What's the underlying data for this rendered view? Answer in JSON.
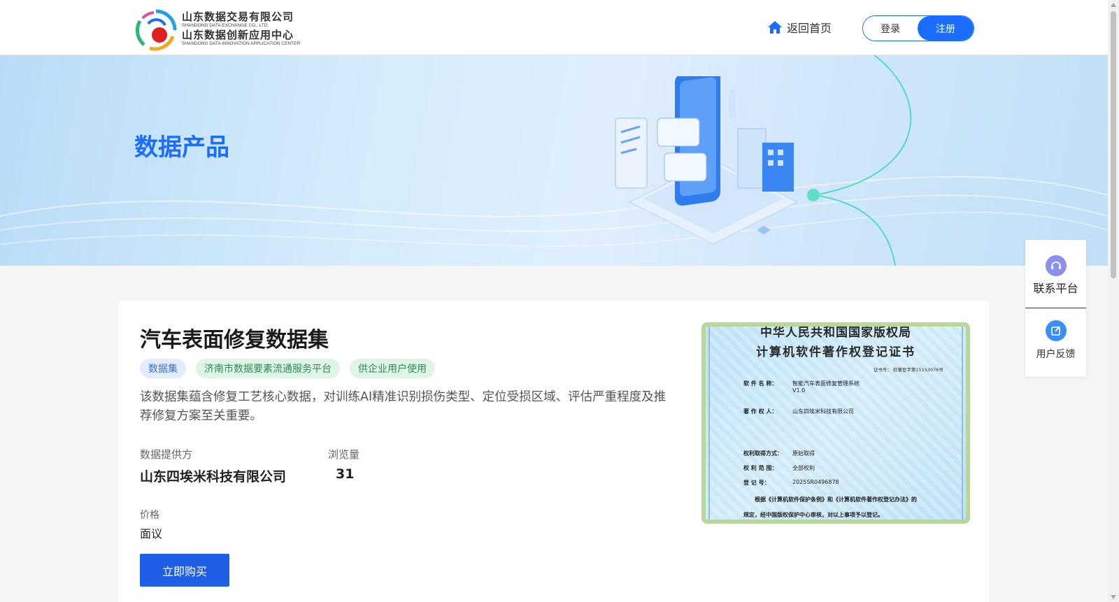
{
  "header": {
    "logo": {
      "line1_cn": "山东数据交易有限公司",
      "line1_en": "SHANDONG DATA EXCHANGE CO., LTD.",
      "line2_cn": "山东数据创新应用中心",
      "line2_en": "SHANDONG DATA INNOVATION APPLICATION CENTER"
    },
    "home_label": "返回首页",
    "login_label": "登录",
    "register_label": "注册",
    "accent": "#1a6dff"
  },
  "banner": {
    "title": "数据产品"
  },
  "product": {
    "title": "汽车表面修复数据集",
    "tags": [
      "数据集",
      "济南市数据要素流通服务平台",
      "供企业用户使用"
    ],
    "description": "该数据集蕴含修复工艺核心数据，对训练AI精准识别损伤类型、定位受损区域、评估严重程度及推荐修复方案至关重要。",
    "provider_label": "数据提供方",
    "provider_value": "山东四埃米科技有限公司",
    "views_label": "浏览量",
    "views_value": "31",
    "price_label": "价格",
    "price_value": "面议",
    "buy_label": "立即购买"
  },
  "certificate": {
    "heading1": "中华人民共和国国家版权局",
    "heading2": "计算机软件著作权登记证书",
    "cert_no": "证书号：  软著登字第15153076号",
    "rows": [
      {
        "k": "软 件 名 称：",
        "v": "智能汽车表面修复管理系统\nV1.0"
      },
      {
        "k": "著 作 权 人：",
        "v": "山东四埃米科技有限公司"
      },
      {
        "k": "权利取得方式：",
        "v": "原始取得"
      },
      {
        "k": "权 利 范 围：",
        "v": "全部权利"
      },
      {
        "k": "登   记   号：",
        "v": "2025SR0496878"
      }
    ],
    "para1": "根据《计算机软件保护条例》和《计算机软件著作权登记办法》的",
    "para2": "规定，经中国版权保护中心审核，对以上事项予以登记。"
  },
  "float_panel": {
    "contact_label": "联系平台",
    "feedback_label": "用户反馈"
  }
}
